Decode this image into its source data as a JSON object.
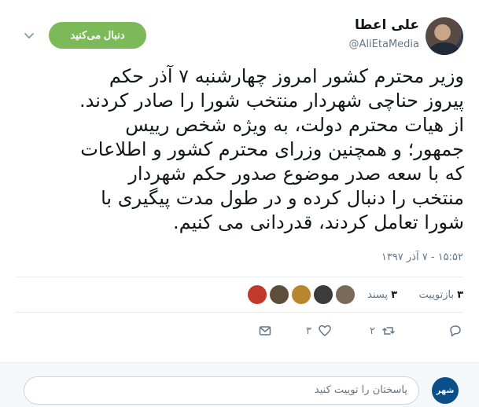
{
  "author": {
    "display_name": "علی اعطا",
    "handle": "@AliEtaMedia",
    "avatar_icon": "profile-photo"
  },
  "follow_button": {
    "label": "دنبال می‌کنید",
    "color": "#7cba59"
  },
  "menu": {
    "icon": "chevron-down-icon"
  },
  "tweet": {
    "lines": [
      "وزیر محترم کشور امروز چهارشنبه ۷ آذر حکم",
      "پیروز حناچی شهردار منتخب شورا را صادر کردند.",
      "از هیات محترم دولت، به ویژه شخص رییس",
      "جمهور؛ و همچنین وزرای محترم کشور و اطلاعات",
      "که با سعه صدر موضوع صدور حکم شهردار",
      "منتخب را دنبال کرده و در طول مدت پیگیری با",
      "شورا تعامل کردند، قدردانی می کنیم."
    ],
    "timestamp": "۱۵:۵۲ - ۷ آذر ۱۳۹۷"
  },
  "stats": {
    "retweets_count": "۳",
    "retweets_label": "بازتوییت",
    "likes_count": "۳",
    "likes_label": "پسند",
    "likers": [
      "#c0392b",
      "#5d4e3c",
      "#b8862e",
      "#3b3b3b",
      "#7a6a5a"
    ]
  },
  "actions": {
    "reply_icon": "reply-icon",
    "retweet_count": "۲",
    "like_count": "۳",
    "message_icon": "envelope-icon"
  },
  "reply": {
    "placeholder": "پاسختان را توییت کنید",
    "avatar_text": "شهر"
  }
}
